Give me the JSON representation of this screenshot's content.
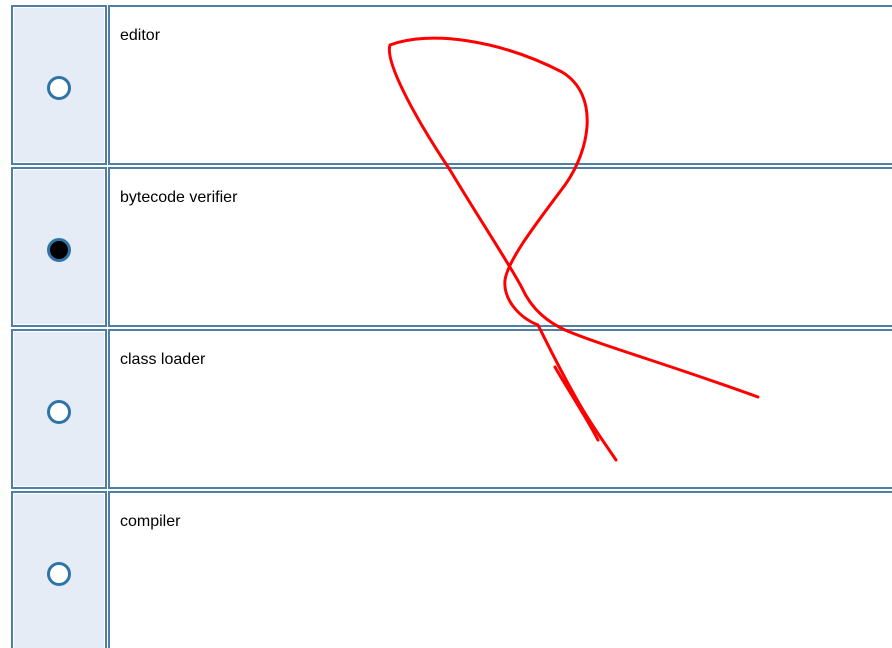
{
  "question": {
    "options": [
      {
        "label": "editor",
        "selected": false
      },
      {
        "label": "bytecode verifier",
        "selected": true
      },
      {
        "label": "class loader",
        "selected": false
      },
      {
        "label": "compiler",
        "selected": false
      }
    ]
  },
  "colors": {
    "cell_border": "#4f7fa6",
    "radio_cell_bg": "#e6ecf5",
    "radio_ring": "#2f74a6",
    "scribble": "#ff0000"
  },
  "icons": {
    "unselected": "radio-button-icon",
    "selected": "radio-button-selected-icon"
  }
}
